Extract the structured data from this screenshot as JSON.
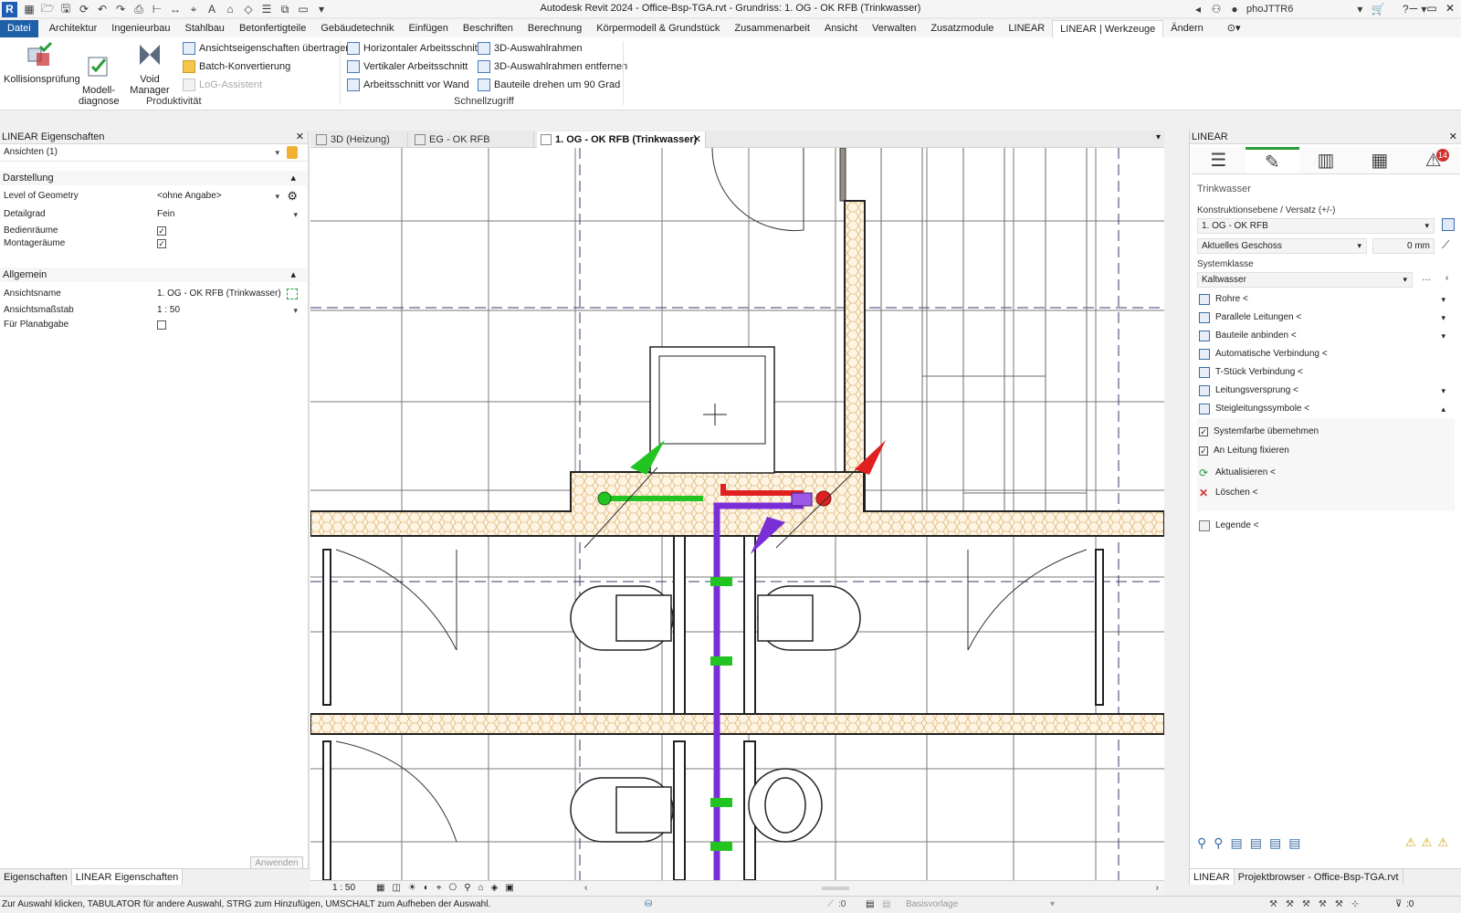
{
  "window": {
    "title": "Autodesk Revit 2024 - Office-Bsp-TGA.rvt - Grundriss: 1. OG - OK RFB (Trinkwasser)",
    "user": "phoJTTR6",
    "app_letter": "R"
  },
  "menu": {
    "file": "Datei",
    "tabs": [
      "Architektur",
      "Ingenieurbau",
      "Stahlbau",
      "Betonfertigteile",
      "Gebäudetechnik",
      "Einfügen",
      "Beschriften",
      "Berechnung",
      "Körpermodell & Grundstück",
      "Zusammenarbeit",
      "Ansicht",
      "Verwalten",
      "Zusatzmodule",
      "LINEAR",
      "LINEAR | Werkzeuge",
      "Ändern"
    ],
    "active_tab": "LINEAR | Werkzeuge"
  },
  "ribbon": {
    "produktivitaet": {
      "label": "Produktivität",
      "big_buttons": [
        "Kollisionsprüfung",
        "Modell-\ndiagnose",
        "Void Manager"
      ],
      "small_buttons": [
        "Ansichtseigenschaften übertragen",
        "Batch-Konvertierung",
        "LoG-Assistent"
      ]
    },
    "schnellzugriff": {
      "label": "Schnellzugriff",
      "col1": [
        "Horizontaler Arbeitsschnitt",
        "Vertikaler Arbeitsschnitt",
        "Arbeitsschnitt vor Wand"
      ],
      "col2": [
        "3D-Auswahlrahmen",
        "3D-Auswahlrahmen entfernen",
        "Bauteile drehen um 90 Grad"
      ]
    }
  },
  "left_panel": {
    "title": "LINEAR Eigenschaften",
    "selector": "Ansichten (1)",
    "sections": {
      "darstellung": "Darstellung",
      "allgemein": "Allgemein"
    },
    "rows": {
      "log_label": "Level of Geometry",
      "log_value": "<ohne Angabe>",
      "detail_label": "Detailgrad",
      "detail_value": "Fein",
      "bedien_label": "Bedienräume",
      "montage_label": "Montageräume",
      "name_label": "Ansichtsname",
      "name_value": "1. OG - OK RFB (Trinkwasser)",
      "scale_label": "Ansichtsmaßstab",
      "scale_value": "1 : 50",
      "plan_label": "Für Planabgabe"
    },
    "apply": "Anwenden",
    "bottom_tabs": [
      "Eigenschaften",
      "LINEAR Eigenschaften"
    ]
  },
  "view_tabs": [
    "3D (Heizung)",
    "EG - OK RFB (Heizung)",
    "1. OG - OK RFB (Trinkwasser)"
  ],
  "view_bar": {
    "scale": "1 : 50"
  },
  "right_panel": {
    "title": "LINEAR",
    "badge": "14",
    "section": "Trinkwasser",
    "konstruktion_label": "Konstruktionsebene / Versatz (+/-)",
    "konstruktion_value": "1. OG - OK RFB",
    "geschoss_value": "Aktuelles Geschoss",
    "offset_value": "0 mm",
    "systemklasse_label": "Systemklasse",
    "systemklasse_value": "Kaltwasser",
    "items": [
      "Rohre <",
      "Parallele Leitungen <",
      "Bauteile anbinden <",
      "Automatische Verbindung <",
      "T-Stück Verbindung <",
      "Leitungsversprung <",
      "Steigleitungssymbole <"
    ],
    "checks": [
      "Systemfarbe übernehmen",
      "An Leitung fixieren"
    ],
    "actions": [
      "Aktualisieren <",
      "Löschen <"
    ],
    "legend": "Legende <",
    "bottom_tabs": [
      "LINEAR",
      "Projektbrowser - Office-Bsp-TGA.rvt"
    ]
  },
  "status": {
    "hint": "Zur Auswahl klicken, TABULATOR für andere Auswahl, STRG zum Hinzufügen, UMSCHALT zum Aufheben der Auswahl.",
    "zero1": ":0",
    "template": "Basisvorlage",
    "filter": ":0"
  },
  "colors": {
    "cold_water": "#22c422",
    "hot_water": "#e02020",
    "circulation": "#7a2fd6",
    "accent_blue": "#1f5fa8"
  }
}
